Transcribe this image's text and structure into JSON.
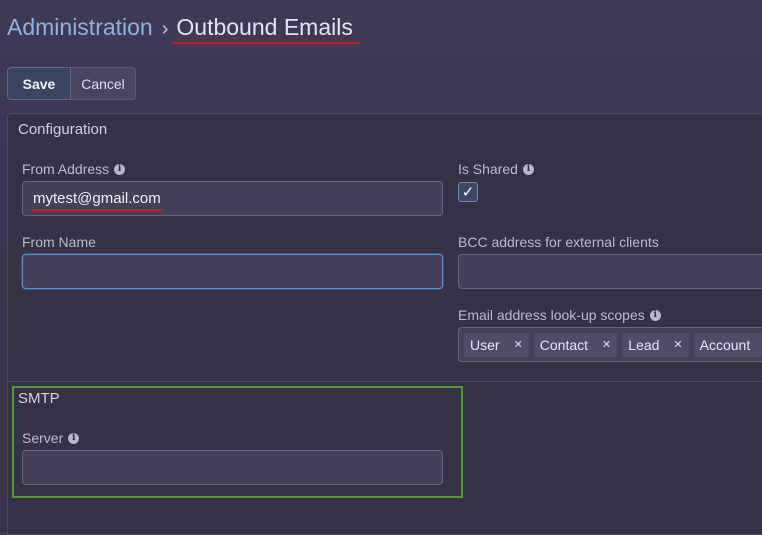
{
  "breadcrumb": {
    "parent": "Administration",
    "separator": "›",
    "current": "Outbound Emails"
  },
  "toolbar": {
    "save_label": "Save",
    "cancel_label": "Cancel"
  },
  "configuration": {
    "title": "Configuration",
    "from_address_label": "From Address",
    "from_address_value": "mytest@gmail.com",
    "from_name_label": "From Name",
    "from_name_value": "",
    "is_shared_label": "Is Shared",
    "is_shared_checked": true,
    "bcc_label": "BCC address for external clients",
    "bcc_value": "",
    "lookup_label": "Email address look-up scopes",
    "lookup_tags": [
      "User",
      "Contact",
      "Lead",
      "Account"
    ]
  },
  "smtp": {
    "title": "SMTP",
    "server_label": "Server",
    "server_value": ""
  },
  "icons": {
    "info": "info-icon",
    "check": "check-icon",
    "remove": "remove-tag-icon"
  },
  "colors": {
    "link": "#8db4e4",
    "annotation_red": "#d01822",
    "annotation_green": "#4f9a2a",
    "save_button": "#394561"
  }
}
